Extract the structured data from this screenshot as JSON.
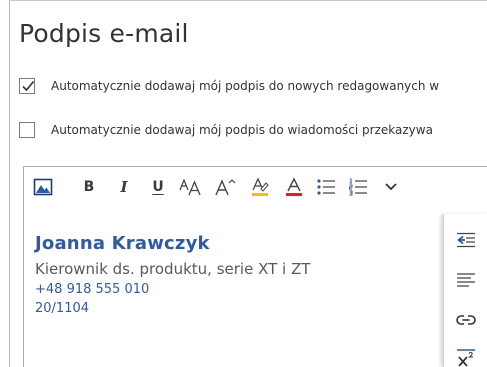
{
  "title": "Podpis e-mail",
  "options": [
    {
      "label": "Automatycznie dodawaj mój podpis do nowych redagowanych w",
      "checked": true
    },
    {
      "label": "Automatycznie dodawaj mój podpis do wiadomości przekazywa",
      "checked": false
    }
  ],
  "toolbar": {
    "bold_glyph": "B",
    "italic_glyph": "I",
    "underline_glyph": "U"
  },
  "signature": {
    "name": "Joanna Krawczyk",
    "role": "Kierownik ds. produktu, serie XT i ZT",
    "phone": "+48 918 555 010",
    "room": "20/1104"
  },
  "colors": {
    "accent_blue": "#2f5aa8",
    "highlight_yellow": "#f2c200",
    "font_color_red": "#e02020",
    "checkmark": "#333333"
  }
}
